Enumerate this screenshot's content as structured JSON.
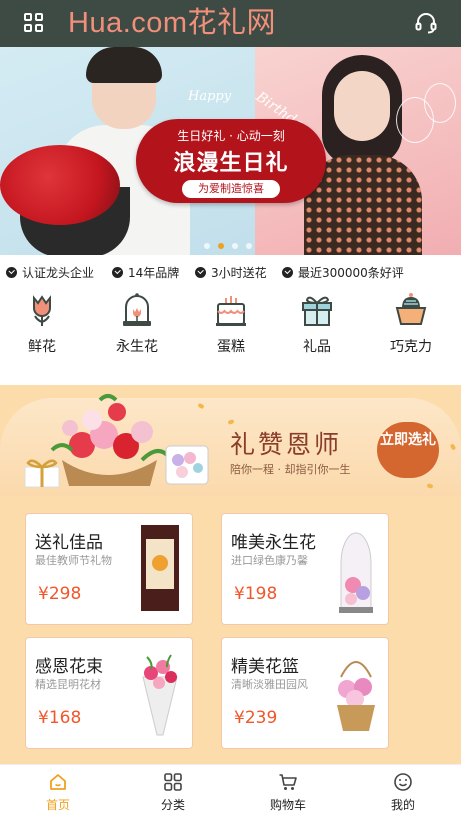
{
  "header": {
    "logo_text": "Hua.com花礼网",
    "menu_icon": "grid-icon",
    "service_icon": "headset-icon"
  },
  "banner": {
    "happy_text": "Happy",
    "birthday_text": "Birthday",
    "subtitle": "生日好礼 · 心动一刻",
    "title": "浪漫生日礼",
    "pill": "为爱制造惊喜",
    "slide_count": 4,
    "active_slide": 2
  },
  "trust_items": [
    "认证龙头企业",
    "14年品牌",
    "3小时送花",
    "最近300000条好评"
  ],
  "categories": [
    {
      "label": "鲜花",
      "icon": "tulip-icon"
    },
    {
      "label": "永生花",
      "icon": "glass-dome-icon"
    },
    {
      "label": "蛋糕",
      "icon": "cake-icon"
    },
    {
      "label": "礼品",
      "icon": "gift-icon"
    },
    {
      "label": "巧克力",
      "icon": "chocolate-icon"
    }
  ],
  "promo": {
    "title": "礼赞恩师",
    "subtitle": "陪你一程 · 却指引你一生",
    "button": "立即选礼"
  },
  "products": [
    {
      "name": "送礼佳品",
      "desc": "最佳教师节礼物",
      "price": "¥298"
    },
    {
      "name": "唯美永生花",
      "desc": "进口绿色康乃馨",
      "price": "¥198"
    },
    {
      "name": "感恩花束",
      "desc": "精选昆明花材",
      "price": "¥168"
    },
    {
      "name": "精美花篮",
      "desc": "清晰淡雅田园风",
      "price": "¥239"
    }
  ],
  "tabbar": [
    {
      "label": "首页",
      "icon": "home-icon",
      "active": true
    },
    {
      "label": "分类",
      "icon": "category-grid-icon",
      "active": false
    },
    {
      "label": "购物车",
      "icon": "cart-icon",
      "active": false
    },
    {
      "label": "我的",
      "icon": "smile-icon",
      "active": false
    }
  ],
  "colors": {
    "header_bg": "#3e4a44",
    "logo": "#f0907a",
    "accent": "#f0a020",
    "price": "#f0572a",
    "promo_bg": "#fddcac",
    "promo_button": "#d4662f",
    "banner_red": "#b3141c"
  }
}
